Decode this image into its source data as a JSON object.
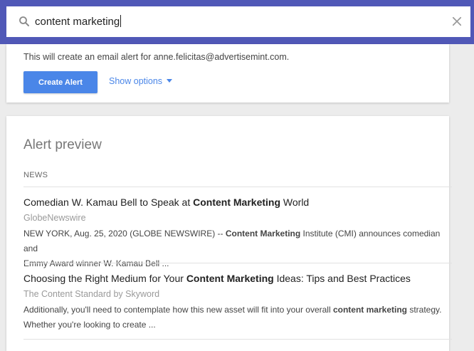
{
  "search": {
    "value": "content marketing",
    "icon": "search-icon",
    "clear_icon": "close-icon"
  },
  "create": {
    "notice": "This will create an email alert for anne.felicitas@advertisemint.com.",
    "button_label": "Create Alert",
    "options_label": "Show options"
  },
  "preview": {
    "title": "Alert preview",
    "section": "NEWS",
    "results": [
      {
        "title_pre": "Comedian W. Kamau Bell to Speak at ",
        "title_bold": "Content Marketing",
        "title_post": " World",
        "source": "GlobeNewswire",
        "snippet_pre": "NEW YORK, Aug. 25, 2020 (GLOBE NEWSWIRE) -- ",
        "snippet_bold": "Content Marketing",
        "snippet_line1_post": " Institute (CMI) announces comedian and",
        "snippet_line2": "Emmy Award winner W. Kamau Bell ..."
      },
      {
        "title_pre": "Choosing the Right Medium for Your ",
        "title_bold": "Content Marketing",
        "title_post": " Ideas: Tips and Best Practices",
        "source": "The Content Standard by Skyword",
        "snippet_pre": "Additionally, you'll need to contemplate how this new asset will fit into your overall ",
        "snippet_bold": "content marketing",
        "snippet_line1_post": " strategy.",
        "snippet_line2": "Whether you're looking to create ..."
      }
    ]
  },
  "colors": {
    "header": "#5058b7",
    "accent": "#4a86e8"
  }
}
